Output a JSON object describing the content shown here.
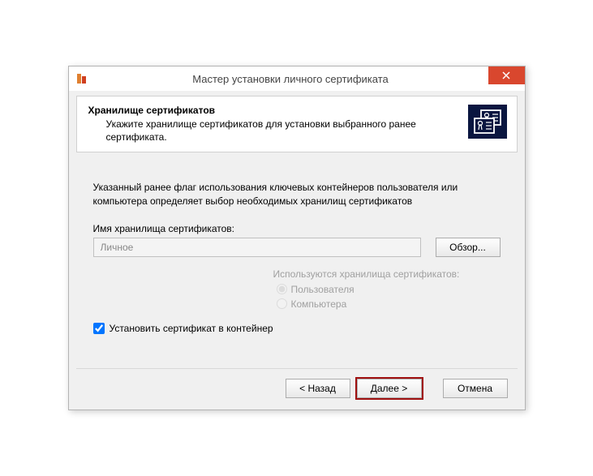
{
  "window": {
    "title": "Мастер установки личного сертификата"
  },
  "header": {
    "title": "Хранилище сертификатов",
    "description": "Укажите хранилище сертификатов для установки выбранного ранее сертификата."
  },
  "content": {
    "info": "Указанный ранее флаг использования ключевых контейнеров пользователя или компьютера определяет выбор необходимых хранилищ сертификатов",
    "store_label": "Имя хранилища сертификатов:",
    "store_value": "Личное",
    "browse_label": "Обзор...",
    "radio_title": "Используются хранилища сертификатов:",
    "radio_user": "Пользователя",
    "radio_computer": "Компьютера",
    "checkbox_label": "Установить сертификат в контейнер"
  },
  "footer": {
    "back": "< Назад",
    "next": "Далее >",
    "cancel": "Отмена"
  }
}
